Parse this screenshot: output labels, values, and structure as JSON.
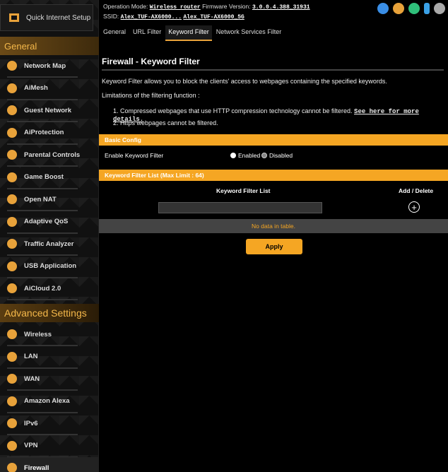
{
  "topbar": {
    "opmode_label": "Operation Mode:",
    "opmode_value": "Wireless router",
    "firmware_label": "Firmware Version:",
    "firmware_value": "3.0.0.4.388_31931",
    "ssid_label": "SSID:",
    "ssid_1": "Alex_TUF-AX6000...",
    "ssid_2": "Alex_TUF-AX6000_5G"
  },
  "sidebar": {
    "quick_setup": "Quick Internet Setup",
    "general_header": "General",
    "general_items": [
      {
        "label": "Network Map",
        "icon": "network-map-icon"
      },
      {
        "label": "AiMesh",
        "icon": "aimesh-icon"
      },
      {
        "label": "Guest Network",
        "icon": "guest-network-icon"
      },
      {
        "label": "AiProtection",
        "icon": "shield-icon"
      },
      {
        "label": "Parental Controls",
        "icon": "parental-icon"
      },
      {
        "label": "Game Boost",
        "icon": "rocket-icon"
      },
      {
        "label": "Open NAT",
        "icon": "nat-icon"
      },
      {
        "label": "Adaptive QoS",
        "icon": "qos-icon"
      },
      {
        "label": "Traffic Analyzer",
        "icon": "traffic-icon"
      },
      {
        "label": "USB Application",
        "icon": "usb-icon"
      },
      {
        "label": "AiCloud 2.0",
        "icon": "cloud-icon"
      }
    ],
    "advanced_header": "Advanced Settings",
    "advanced_items": [
      {
        "label": "Wireless",
        "icon": "wireless-icon"
      },
      {
        "label": "LAN",
        "icon": "lan-icon"
      },
      {
        "label": "WAN",
        "icon": "wan-icon"
      },
      {
        "label": "Amazon Alexa",
        "icon": "alexa-icon"
      },
      {
        "label": "IPv6",
        "icon": "ipv6-icon"
      },
      {
        "label": "VPN",
        "icon": "vpn-icon"
      },
      {
        "label": "Firewall",
        "icon": "firewall-icon"
      }
    ]
  },
  "tabs": [
    "General",
    "URL Filter",
    "Keyword Filter",
    "Network Services Filter"
  ],
  "main": {
    "title": "Firewall - Keyword Filter",
    "desc": "Keyword Filter allows you to block the clients' access to webpages containing the specified keywords.",
    "limitations": "Limitations of the filtering function :",
    "limit_1": "1. Compressed webpages that use HTTP compression technology cannot be filtered.",
    "limit_1_link": "See here for more details.",
    "limit_2": "2. Https webpages cannot be filtered.",
    "basic_config": "Basic Config",
    "enable_label": "Enable Keyword Filter",
    "enabled": "Enabled",
    "disabled": "Disabled",
    "list_header": "Keyword Filter List (Max Limit : 64)",
    "col_list": "Keyword Filter List",
    "col_add": "Add / Delete",
    "nodata": "No data in table.",
    "apply": "Apply"
  },
  "colors": {
    "accent": "#f5a623",
    "bg": "#000000"
  }
}
